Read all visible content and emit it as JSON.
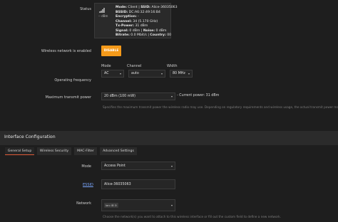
{
  "status": {
    "label": "Status",
    "signal_text": "-- dBm",
    "lines": [
      {
        "key": "Mode:",
        "value": " Client | ",
        "key2": "SSID:",
        "value2": " Alice-36035063"
      },
      {
        "key": "BSSID:",
        "value": " DC:A6:32:49:16:B4"
      },
      {
        "key": "Encryption:",
        "value": " -"
      },
      {
        "key": "Channel:",
        "value": " 34 (5.170 GHz)"
      },
      {
        "key": "Tx-Power:",
        "value": " 31 dBm"
      },
      {
        "key": "Signal:",
        "value": " 0 dBm | ",
        "key2": "Noise:",
        "value2": " 0 dBm"
      },
      {
        "key": "Bitrate:",
        "value": " 0.0 Mbit/s | ",
        "key2": "Country:",
        "value2": " 00"
      }
    ]
  },
  "wireless_enabled": {
    "label": "Wireless network is enabled",
    "button": "DISABLE"
  },
  "operating_frequency": {
    "label": "Operating frequency",
    "mode_label": "Mode",
    "channel_label": "Channel",
    "width_label": "Width",
    "mode_value": "AC",
    "channel_value": "auto",
    "width_value": "80 MHz"
  },
  "tx_power": {
    "label": "Maximum transmit power",
    "value": "20 dBm (100 mW)",
    "current": "- Current power: 31 dBm",
    "help": "Specifies the maximum transmit power the wireless radio may use. Depending on regulatory requirements and wireless usage, the actual transmit power may be reduced by the driver."
  },
  "interface_config": {
    "title": "Interface Configuration",
    "tabs": [
      "General Setup",
      "Wireless Security",
      "MAC-Filter",
      "Advanced Settings"
    ]
  },
  "mode": {
    "label": "Mode",
    "value": "Access Point"
  },
  "essid": {
    "label": "ESSID",
    "value": "Alice-36035063"
  },
  "network": {
    "label": "Network",
    "chip_text": "lan:",
    "help": "Choose the network(s) you want to attach to this wireless interface or fill out the custom field to define a new network."
  }
}
